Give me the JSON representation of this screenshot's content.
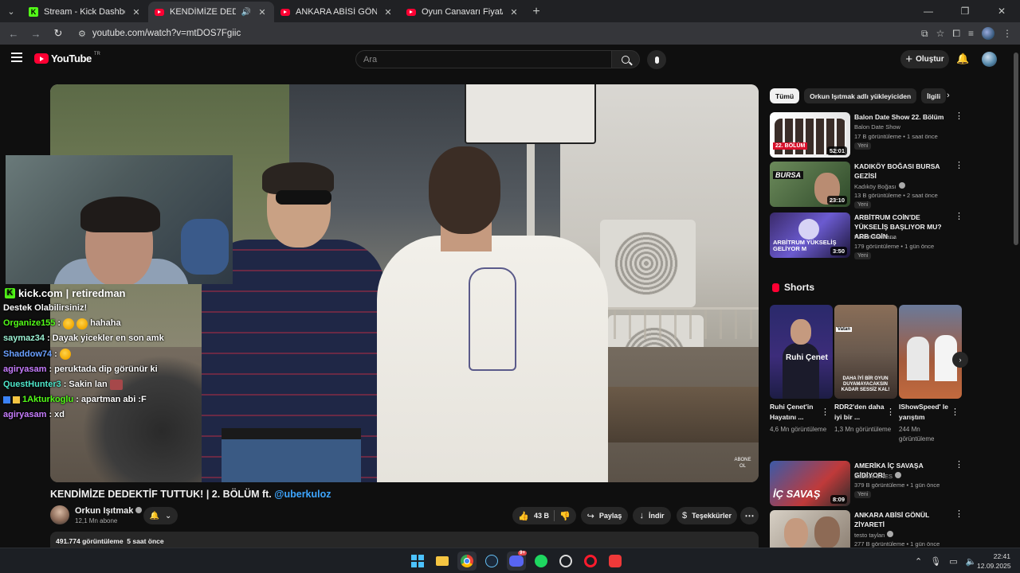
{
  "browser": {
    "tabs": [
      {
        "title": "Stream - Kick Dashboard",
        "favicon": "kick-icon",
        "active": false
      },
      {
        "title": "KENDİMİZE DEDEKTİF TUTT",
        "favicon": "youtube-icon",
        "active": true,
        "audio": true
      },
      {
        "title": "ANKARA ABİSİ GÖNÜL ZİYARET",
        "favicon": "youtube-icon",
        "active": false
      },
      {
        "title": "Oyun Canavarı Fiyat/Performan",
        "favicon": "youtube-icon",
        "active": false
      }
    ],
    "url": "youtube.com/watch?v=mtDOS7Fgiic"
  },
  "youtube": {
    "logo_text": "YouTube",
    "logo_region": "TR",
    "search_placeholder": "Ara",
    "create_label": "Oluştur",
    "video_title": "KENDİMİZE DEDEKTİF TUTTUK! | 2. BÖLÜM ft.",
    "video_mention": "@uberkuloz",
    "channel_name": "Orkun Işıtmak",
    "channel_subs": "12,1 Mn abone",
    "like_count": "43 B",
    "share_label": "Paylaş",
    "download_label": "İndir",
    "thanks_label": "Teşekkürler",
    "desc_views": "491.774 görüntüleme",
    "desc_time": "5 saat önce",
    "watermark": "ABONE OL"
  },
  "overlay": {
    "kick_brand": "kick.com",
    "kick_channel": "retiredman",
    "chat": [
      {
        "text": "Destek Olabilirsiniz!"
      },
      {
        "user": "Organize155",
        "msg": "hahaha"
      },
      {
        "user": "saymaz34",
        "msg": "Dayak yicekler en son amk"
      },
      {
        "user": "Shaddow74",
        "msg": ""
      },
      {
        "user": "agiryasam",
        "msg": "peruktada dip görünür ki"
      },
      {
        "user": "QuestHunter3",
        "msg": "Sakin lan"
      },
      {
        "user": "1Akturkoglu",
        "msg": "apartman abi :F"
      },
      {
        "user": "agiryasam",
        "msg": "xd"
      }
    ]
  },
  "sidebar": {
    "chips": [
      "Tümü",
      "Orkun Işıtmak adlı yükleyiciden",
      "İlgili"
    ],
    "recs": [
      {
        "title": "Balon Date Show 22. Bölüm",
        "channel": "Balon Date Show",
        "meta": "17 B görüntüleme • 1 saat önce",
        "badge": "Yeni",
        "duration": "52:01",
        "thumb_text": "22. BÖLÜM"
      },
      {
        "title": "KADIKÖY BOĞASI BURSA GEZİSİ",
        "channel": "Kadıköy Boğası",
        "meta": "13 B görüntüleme • 2 saat önce",
        "badge": "Yeni",
        "duration": "23:10",
        "thumb_text": "BURSA"
      },
      {
        "title": "ARBİTRUM COİN'DE YÜKSELİŞ BAŞLIYOR MU? ARB COİN ...",
        "channel": "Hasan Montana",
        "meta": "179 görüntüleme • 1 gün önce",
        "badge": "Yeni",
        "duration": "3:50",
        "thumb_text": "ARBİTRUM YÜKSELİŞ GELİYOR M"
      },
      {
        "title": "AMERİKA İÇ SAVAŞA GİDİYOR!",
        "channel": "Sadece ENES",
        "meta": "379 B görüntüleme • 1 gün önce",
        "badge": "Yeni",
        "duration": "8:09",
        "thumb_text": "İÇ SAVAŞ"
      },
      {
        "title": "ANKARA ABİSİ GÖNÜL ZİYARETİ",
        "channel": "testo taylan",
        "meta": "277 B görüntüleme • 1 gün önce",
        "badge": "",
        "duration": "",
        "thumb_text": ""
      }
    ],
    "shorts_title": "Shorts",
    "shorts": [
      {
        "title": "Ruhi Çenet'in Hayatını ...",
        "views": "4,6 Mn görüntüleme",
        "thumb_text": "Ruhi Çenet"
      },
      {
        "title": "RDR2'den daha iyi bir ...",
        "views": "1,3 Mn görüntüleme",
        "thumb_text": "DAHA İYİ BİR OYUN DUYAMAYACAKSIN KADAR SESSİZ KAL!"
      },
      {
        "title": "IShowSpeed' le yarıştım",
        "views": "244 Mn görüntüleme",
        "thumb_text": ""
      }
    ]
  },
  "taskbar": {
    "time": "22:41",
    "date": "12.09.2025",
    "discord_badge": "9+"
  }
}
